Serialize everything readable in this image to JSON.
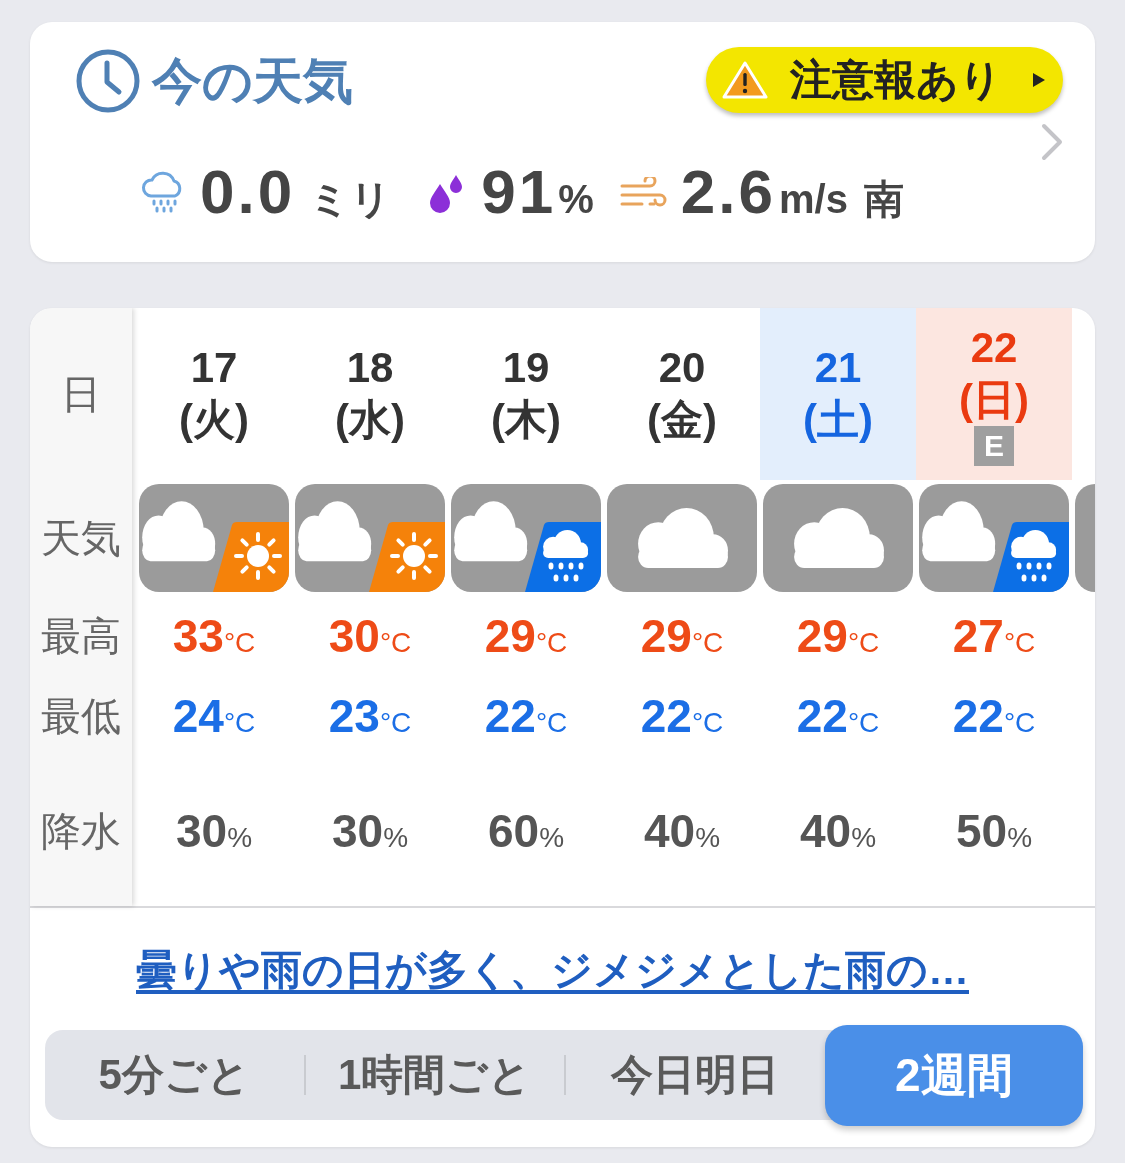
{
  "current": {
    "title": "今の天気",
    "alert": {
      "label": "注意報あり"
    },
    "rain": {
      "value": "0.0",
      "unit": "ミリ"
    },
    "humidity": {
      "value": "91",
      "unit": "%"
    },
    "wind": {
      "value": "2.6",
      "unit": "m/s",
      "direction": "南"
    }
  },
  "forecast": {
    "row_labels": [
      "日",
      "天気",
      "最高",
      "最低",
      "降水"
    ],
    "days": [
      {
        "date": "17",
        "weekday": "(火)",
        "kind": "weekday",
        "weather": {
          "kind": "cloud_sun"
        },
        "high": "33",
        "high_unit": "°C",
        "low": "24",
        "low_unit": "°C",
        "precip": "30",
        "precip_unit": "%"
      },
      {
        "date": "18",
        "weekday": "(水)",
        "kind": "weekday",
        "weather": {
          "kind": "cloud_sun"
        },
        "high": "30",
        "high_unit": "°C",
        "low": "23",
        "low_unit": "°C",
        "precip": "30",
        "precip_unit": "%"
      },
      {
        "date": "19",
        "weekday": "(木)",
        "kind": "weekday",
        "weather": {
          "kind": "cloud_rain"
        },
        "high": "29",
        "high_unit": "°C",
        "low": "22",
        "low_unit": "°C",
        "precip": "60",
        "precip_unit": "%"
      },
      {
        "date": "20",
        "weekday": "(金)",
        "kind": "weekday",
        "weather": {
          "kind": "cloud"
        },
        "high": "29",
        "high_unit": "°C",
        "low": "22",
        "low_unit": "°C",
        "precip": "40",
        "precip_unit": "%"
      },
      {
        "date": "21",
        "weekday": "(土)",
        "kind": "saturday",
        "weather": {
          "kind": "cloud"
        },
        "high": "29",
        "high_unit": "°C",
        "low": "22",
        "low_unit": "°C",
        "precip": "40",
        "precip_unit": "%"
      },
      {
        "date": "22",
        "weekday": "(日)",
        "kind": "sunday",
        "badge": "E",
        "weather": {
          "kind": "cloud_rain"
        },
        "high": "27",
        "high_unit": "°C",
        "low": "22",
        "low_unit": "°C",
        "precip": "50",
        "precip_unit": "%"
      }
    ],
    "more_columns": true
  },
  "summary_link": "曇りや雨の日が多く、ジメジメとした雨の…",
  "tabs": [
    {
      "label": "5分ごと",
      "selected": false
    },
    {
      "label": "1時間ごと",
      "selected": false
    },
    {
      "label": "今日明日",
      "selected": false
    },
    {
      "label": "2週間",
      "selected": true
    }
  ]
}
